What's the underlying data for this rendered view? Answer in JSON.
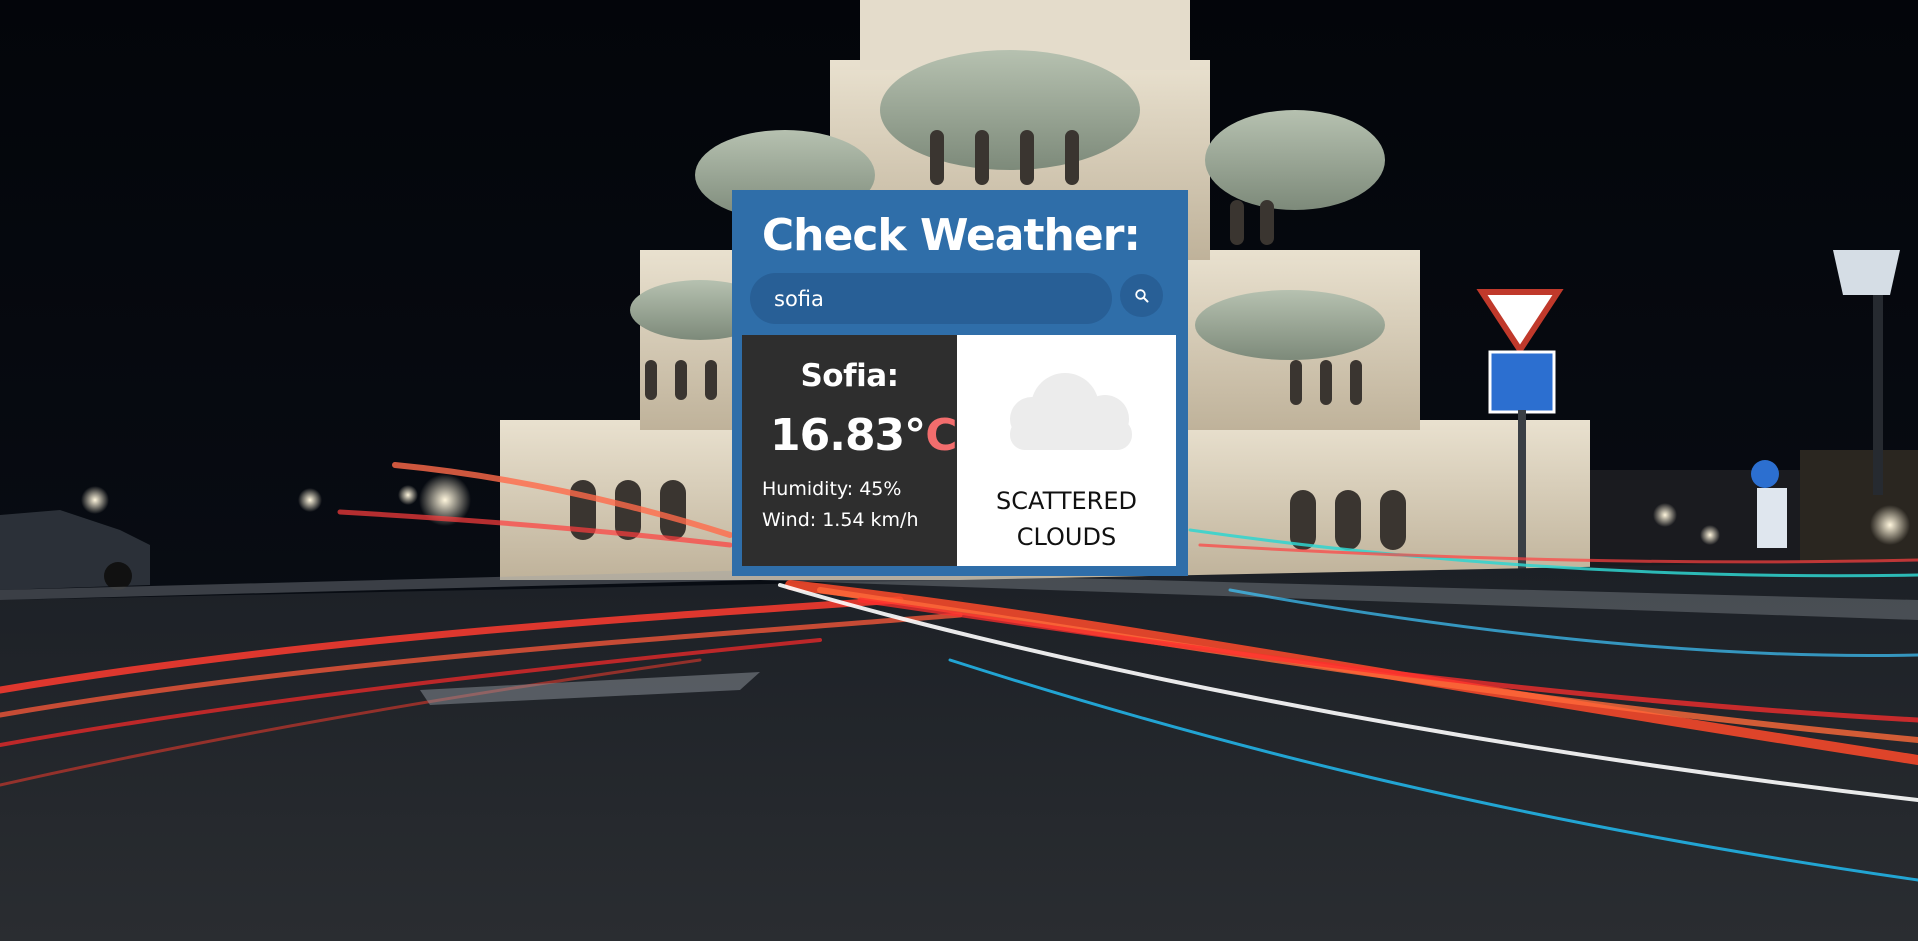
{
  "header": {
    "title": "Check Weather:"
  },
  "search": {
    "value": "sofia",
    "button_icon": "search-icon"
  },
  "weather": {
    "city_label": "Sofia:",
    "temperature_value": "16.83°",
    "temperature_unit": "C",
    "humidity_text": "Humidity: 45%",
    "wind_text": "Wind: 1.54 km/h",
    "condition": "SCATTERED CLOUDS",
    "condition_icon": "cloud-icon"
  },
  "colors": {
    "panel_blue": "#2f6ea9",
    "input_blue": "#285f96",
    "dark_card": "#2e2e2e",
    "unit_red": "#f26d6d",
    "cloud_gray": "#ececec"
  },
  "background": {
    "description_icon": "night-cathedral-light-trails-photo"
  }
}
